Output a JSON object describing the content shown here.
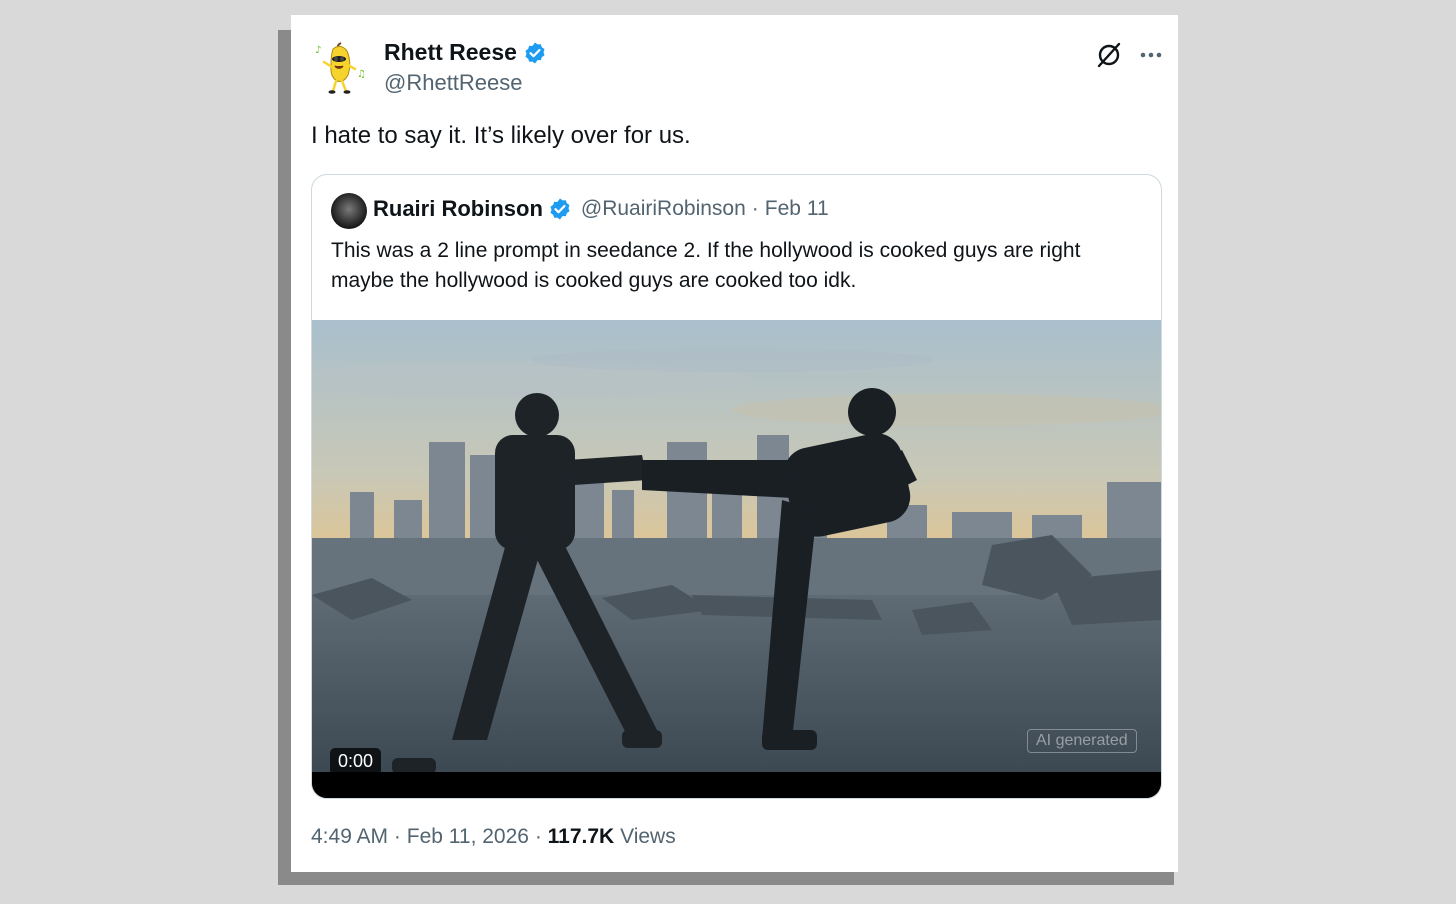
{
  "tweet": {
    "author_name": "Rhett Reese",
    "author_handle": "@RhettReese",
    "avatar_icon": "dancing-banana-icon",
    "text": "I hate to say it. It’s likely over for us.",
    "time": "4:49 AM",
    "separator": "·",
    "date": "Feb 11, 2026",
    "views_count": "117.7K",
    "views_label": "Views"
  },
  "quoted": {
    "author_name": "Ruairi Robinson",
    "author_handle": "@RuairiRobinson",
    "separator": "·",
    "date": "Feb 11",
    "text": "This was a 2 line prompt in seedance 2. If the hollywood is cooked guys are right maybe the hollywood is cooked guys are cooked too idk.",
    "video": {
      "timestamp": "0:00",
      "ai_label": "AI generated"
    }
  },
  "icons": {
    "verified": "verified-badge-icon",
    "grok": "grok-icon",
    "more": "more-options-icon"
  },
  "colors": {
    "verified_blue": "#1d9bf0",
    "text_primary": "#0f1419",
    "text_secondary": "#536471",
    "border": "#cfd9de"
  }
}
